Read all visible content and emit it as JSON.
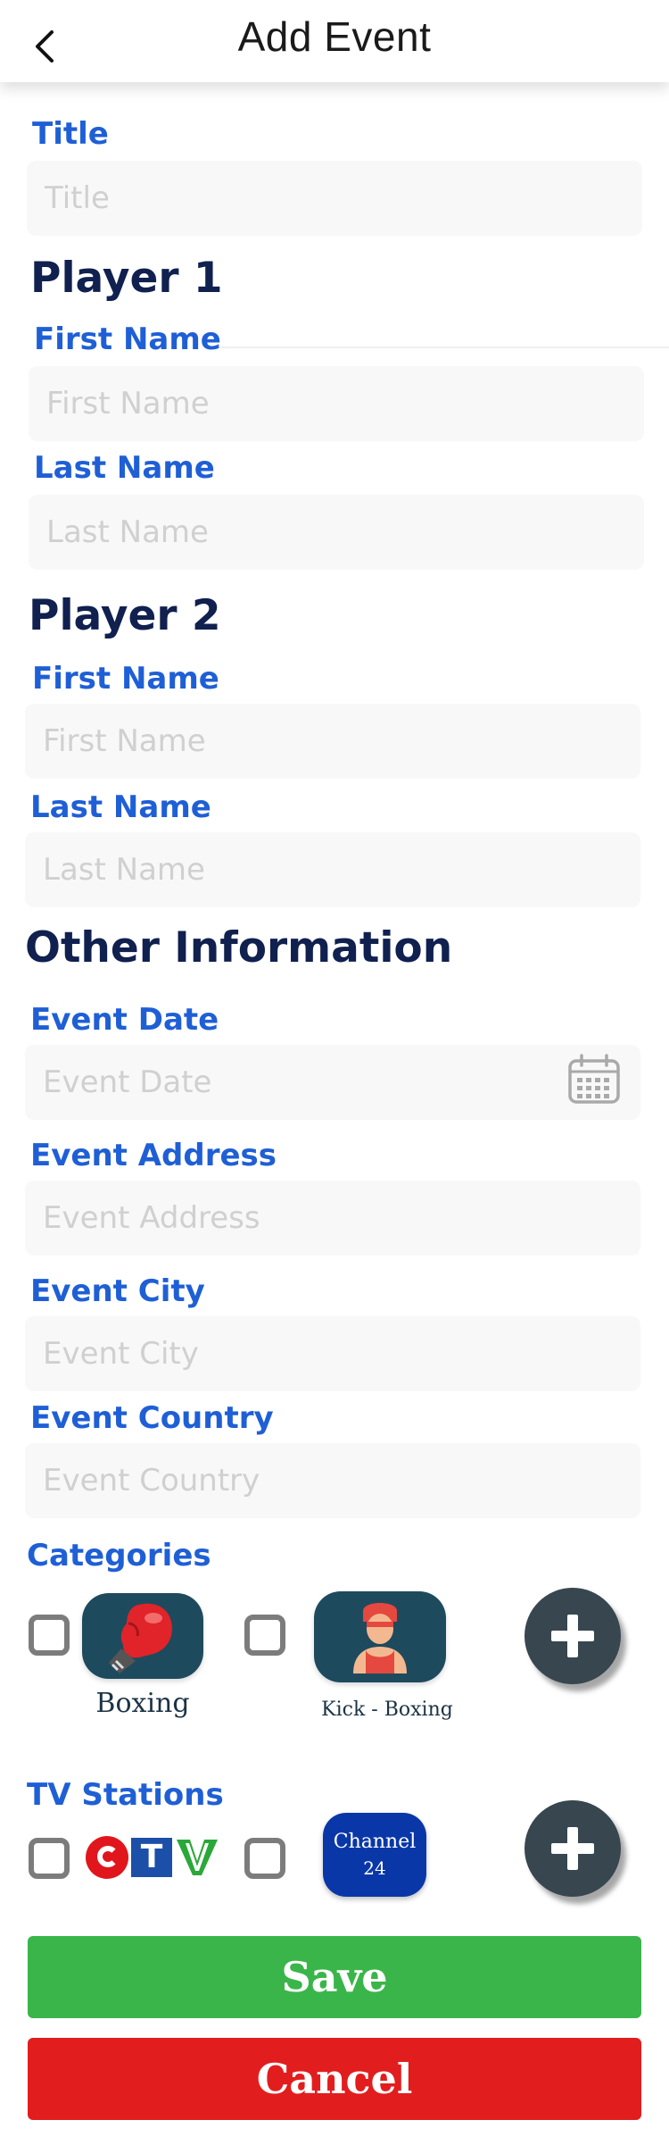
{
  "header": {
    "title": "Add Event"
  },
  "title_field": {
    "label": "Title",
    "placeholder": "Title"
  },
  "player1": {
    "heading": "Player 1",
    "first_name": {
      "label": "First Name",
      "placeholder": "First Name"
    },
    "last_name": {
      "label": "Last Name",
      "placeholder": "Last Name"
    }
  },
  "player2": {
    "heading": "Player 2",
    "first_name": {
      "label": "First Name",
      "placeholder": "First Name"
    },
    "last_name": {
      "label": "Last Name",
      "placeholder": "Last Name"
    }
  },
  "other": {
    "heading": "Other Information",
    "event_date": {
      "label": "Event Date",
      "placeholder": "Event Date"
    },
    "event_address": {
      "label": "Event Address",
      "placeholder": "Event Address"
    },
    "event_city": {
      "label": "Event City",
      "placeholder": "Event City"
    },
    "event_country": {
      "label": "Event Country",
      "placeholder": "Event Country"
    }
  },
  "categories": {
    "label": "Categories",
    "items": [
      {
        "name": "Boxing",
        "icon": "boxing-glove-icon",
        "checked": false
      },
      {
        "name": "Kick - Boxing",
        "icon": "kickboxer-icon",
        "checked": false
      }
    ],
    "add_icon": "plus-icon"
  },
  "tv_stations": {
    "label": "TV Stations",
    "items": [
      {
        "logo": "ctv-logo",
        "text": [
          "C",
          "T",
          "V"
        ],
        "checked": false
      },
      {
        "logo": "channel-24-logo",
        "line1": "Channel",
        "line2": "24",
        "checked": false
      }
    ],
    "add_icon": "plus-icon"
  },
  "actions": {
    "save_label": "Save",
    "cancel_label": "Cancel"
  },
  "colors": {
    "label_blue": "#1f5fd6",
    "heading_navy": "#10204f",
    "save_green": "#3ab54a",
    "cancel_red": "#e21d1e",
    "tile_teal": "#1e4a5e",
    "channel_blue": "#0a37a8",
    "plus_dark": "#37464f"
  }
}
